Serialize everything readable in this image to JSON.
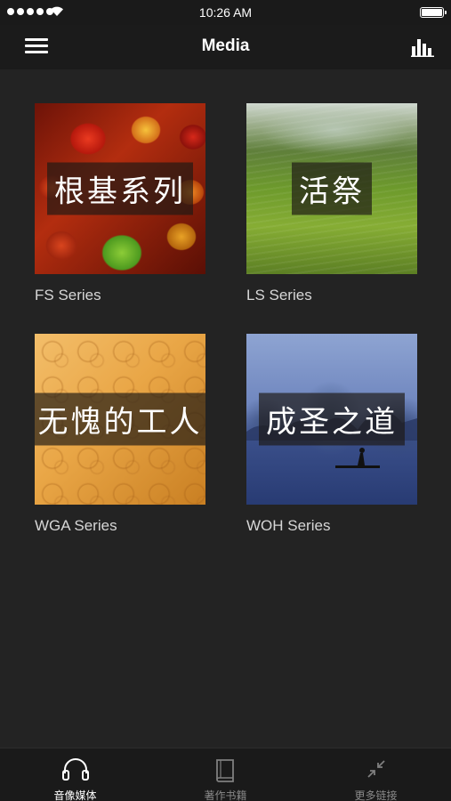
{
  "status_bar": {
    "time": "10:26 AM"
  },
  "nav": {
    "title": "Media"
  },
  "series": [
    {
      "thumb_title": "根基系列",
      "caption": "FS Series"
    },
    {
      "thumb_title": "活祭",
      "caption": "LS Series"
    },
    {
      "thumb_title": "无愧的工人",
      "caption": "WGA Series"
    },
    {
      "thumb_title": "成圣之道",
      "caption": "WOH Series"
    }
  ],
  "tabs": [
    {
      "label": "音像媒体",
      "icon": "headphones-icon",
      "active": true
    },
    {
      "label": "著作书籍",
      "icon": "book-icon",
      "active": false
    },
    {
      "label": "更多链接",
      "icon": "arrows-icon",
      "active": false
    }
  ],
  "colors": {
    "background": "#232323",
    "bars": "#1b1b1b",
    "active_tab": "#ffffff",
    "inactive_tab": "#8a8a8a"
  }
}
